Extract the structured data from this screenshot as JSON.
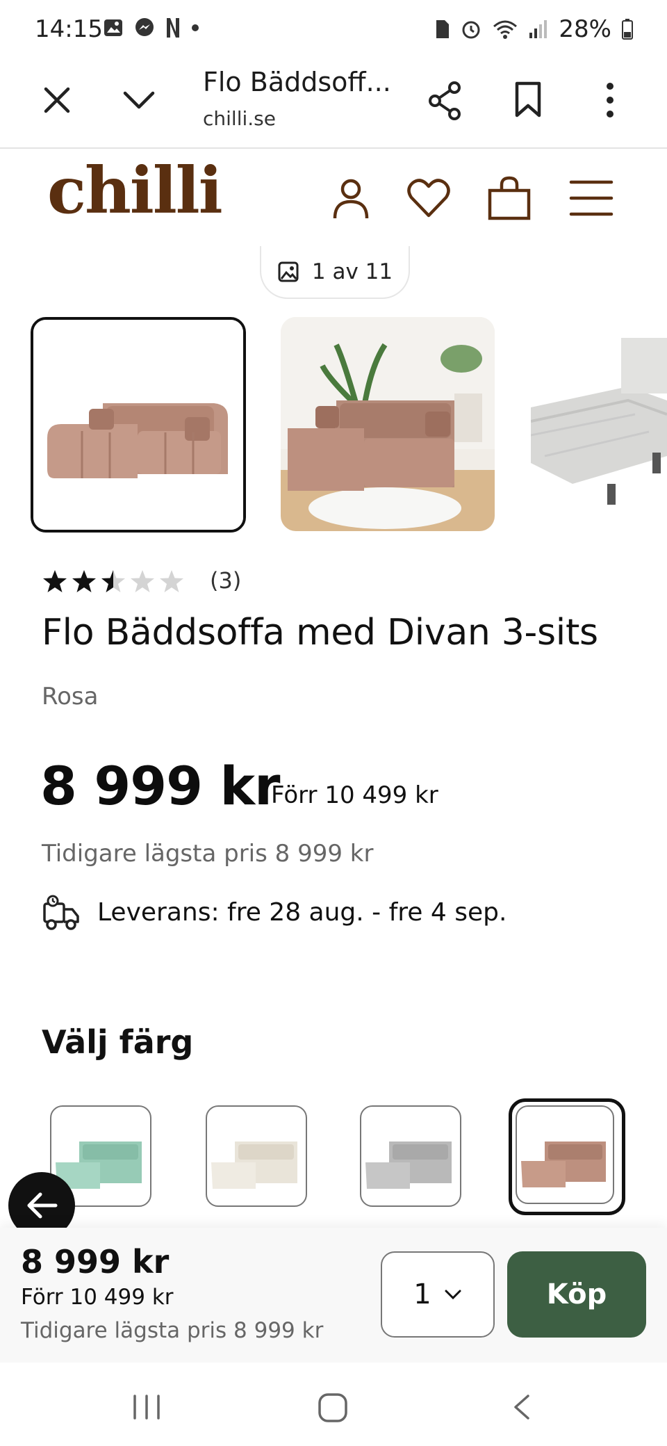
{
  "status_bar": {
    "time": "14:15",
    "battery": "28%",
    "icons": [
      "gallery-icon",
      "messenger-icon",
      "netflix-icon",
      "dot-icon",
      "sim-icon",
      "alarm-icon",
      "wifi-icon",
      "signal-icon",
      "battery-icon"
    ]
  },
  "browser": {
    "page_title": "Flo Bäddsoff...",
    "domain": "chilli.se",
    "icons": [
      "close-icon",
      "chevron-down-icon",
      "share-icon",
      "bookmark-icon",
      "more-icon"
    ]
  },
  "site_header": {
    "logo": "chilli",
    "icons": [
      "account-icon",
      "heart-icon",
      "cart-icon",
      "menu-icon"
    ],
    "brand_color": "#5a2f10"
  },
  "gallery": {
    "counter": "1 av 11",
    "images": [
      "sofa-pink-front",
      "sofa-pink-living-room",
      "sofa-white-bed"
    ],
    "selected_index": 0
  },
  "product": {
    "rating": 2.5,
    "rating_max": 5,
    "review_count": "(3)",
    "title": "Flo Bäddsoffa med Divan 3-sits",
    "color": "Rosa",
    "price": "8 999 kr",
    "was_price": "Förr 10 499 kr",
    "lowest_price": "Tidigare lägsta pris 8 999 kr",
    "delivery": "Leverans: fre 28 aug. - fre 4 sep."
  },
  "color_picker": {
    "heading": "Välj färg",
    "swatches": [
      {
        "name": "mint",
        "color": "#9fd0bd"
      },
      {
        "name": "cream",
        "color": "#ece7dd"
      },
      {
        "name": "grey",
        "color": "#bdbdbd"
      },
      {
        "name": "rosa",
        "color": "#c29684"
      }
    ],
    "selected_index": 3
  },
  "sticky_bar": {
    "price": "8 999 kr",
    "was_price": "Förr 10 499 kr",
    "lowest_price": "Tidigare lägsta pris 8 999 kr",
    "quantity": "1",
    "buy_label": "Köp",
    "buy_color": "#3d5f43"
  },
  "nav_bar": {
    "icons": [
      "recents-icon",
      "home-icon",
      "back-icon"
    ]
  }
}
